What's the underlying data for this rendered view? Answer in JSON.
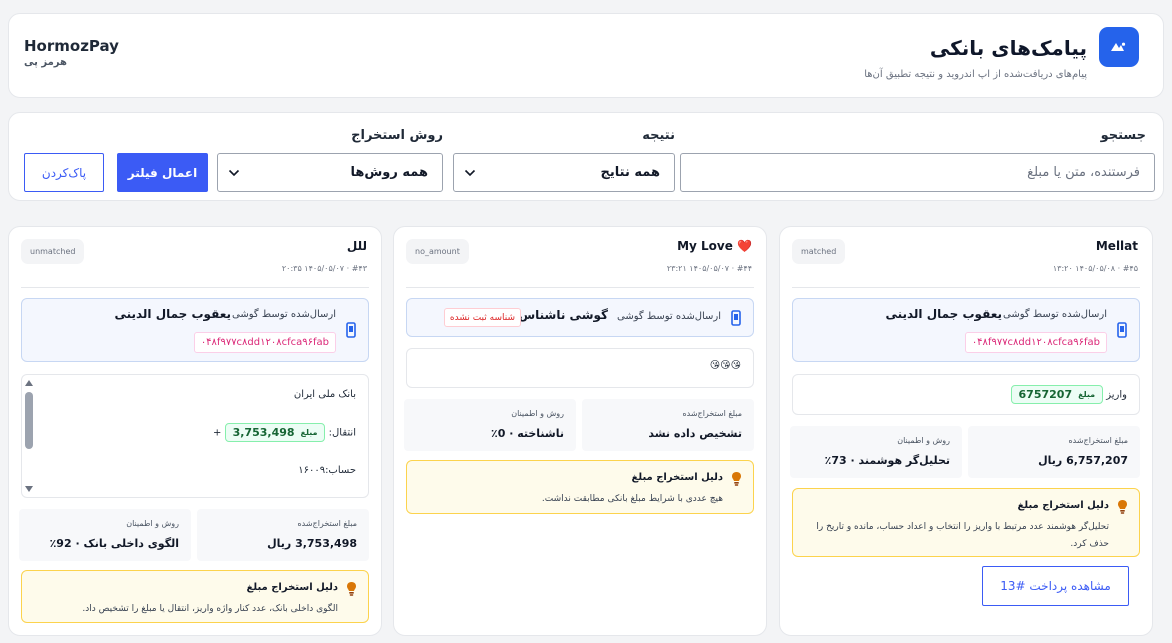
{
  "header": {
    "title": "پیامک‌های بانکی",
    "subtitle": "پیام‌های دریافت‌شده از اپ اندروید و نتیجه تطبیق آن‌ها",
    "brand_name": "HormozPay",
    "brand_sub": "هرمز پی",
    "logo_icon": "brand-logo-icon",
    "accent_color": "#2563eb"
  },
  "filters": {
    "search_label": "جستجو",
    "search_placeholder": "فرستنده، متن یا مبلغ",
    "search_value": "",
    "result_label": "نتیجه",
    "result_value": "همه نتایج",
    "method_label": "روش استخراج",
    "method_value": "همه روش‌ها",
    "apply_label": "اعمال فیلتر",
    "clear_label": "پاک‌کردن"
  },
  "cards": [
    {
      "sender": "Mellat",
      "meta": "#۴۵ · ۱۴۰۵/۰۵/۰۸ ۱۳:۲۰",
      "status": "matched",
      "device": {
        "via": "ارسال‌شده توسط گوشی",
        "name": "یعقوب جمال الدینی",
        "id": "۰۴۸f۹۷۷c۸dd۱۲۰۸cfca۹۶fab"
      },
      "message": {
        "prefix": "واریز",
        "amount_label": "مبلغ",
        "amount": "6757207"
      },
      "extracted_label": "مبلغ استخراج‌شده",
      "extracted_value": "6,757,207 ریال",
      "method_label": "روش و اطمینان",
      "method_value": "تحلیل‌گر هوشمند · 73٪",
      "reason_title": "دلیل استخراج مبلغ",
      "reason_text": "تحلیل‌گر هوشمند عدد مرتبط با واریز را انتخاب و اعداد حساب، مانده و تاریخ را حذف کرد.",
      "view_button": "مشاهده پرداخت #13"
    },
    {
      "sender": "My Love ❤️",
      "meta": "#۴۴ · ۱۴۰۵/۰۵/۰۷ ۲۳:۲۱",
      "status": "no_amount",
      "device": {
        "via": "ارسال‌شده توسط گوشی",
        "name": "گوشی ناشناس",
        "unregistered": "شناسه ثبت نشده"
      },
      "message": {
        "text": "😘😘😘"
      },
      "extracted_label": "مبلغ استخراج‌شده",
      "extracted_value": "تشخیص داده نشد",
      "method_label": "روش و اطمینان",
      "method_value": "ناشناخته · 0٪",
      "reason_title": "دلیل استخراج مبلغ",
      "reason_text": "هیچ عددی با شرایط مبلغ بانکی مطابقت نداشت."
    },
    {
      "sender": "للل",
      "meta": "#۴۳ · ۱۴۰۵/۰۵/۰۷ ۲۰:۳۵",
      "status": "unmatched",
      "device": {
        "via": "ارسال‌شده توسط گوشی",
        "name": "یعقوب جمال الدینی",
        "id": "۰۴۸f۹۷۷c۸dd۱۲۰۸cfca۹۶fab"
      },
      "message": {
        "line1": "بانک ملی ایران",
        "prefix": "انتقال:",
        "amount_label": "مبلغ",
        "amount": "3,753,498",
        "suffix": "+",
        "line3": "حساب:۱۶۰۰۹"
      },
      "extracted_label": "مبلغ استخراج‌شده",
      "extracted_value": "3,753,498 ریال",
      "method_label": "روش و اطمینان",
      "method_value": "الگوی داخلی بانک · 92٪",
      "reason_title": "دلیل استخراج مبلغ",
      "reason_text": "الگوی داخلی بانک، عدد کنار واژه واریز، انتقال یا مبلغ را تشخیص داد."
    }
  ]
}
